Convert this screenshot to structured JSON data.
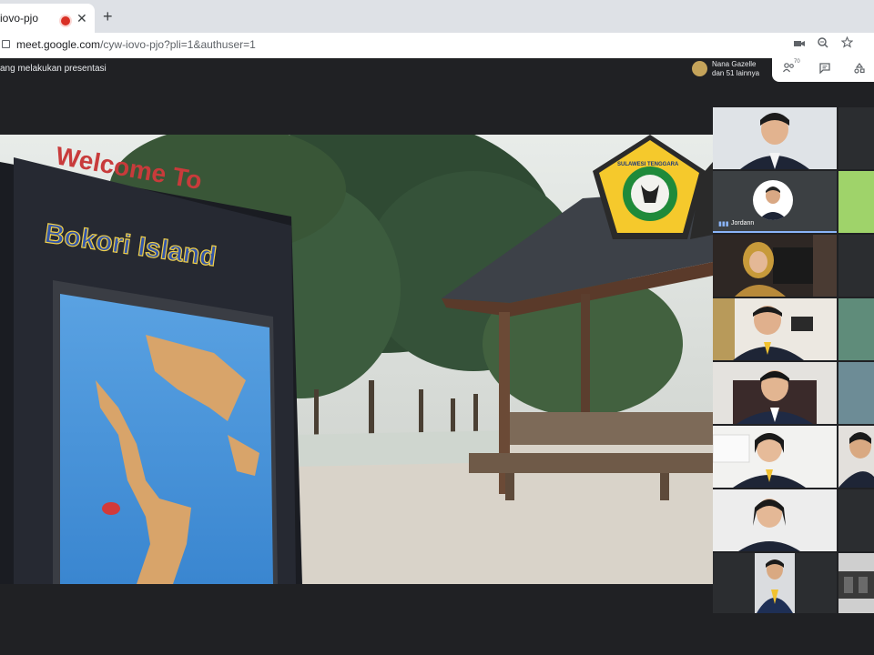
{
  "browser": {
    "tab_title": "iovo-pjo",
    "close_glyph": "✕",
    "new_tab_glyph": "+",
    "url_host": "meet.google.com",
    "url_path": "/cyw-iovo-pjo?pli=1&authuser=1"
  },
  "meet": {
    "presenting_text": "ang melakukan presentasi",
    "viewer_name": "Nana Gazelle",
    "viewer_more": "dan 51 lainnya",
    "people_count": "70",
    "speaking_label": "Jordann"
  },
  "presentation": {
    "sign_line1": "Welcome To",
    "sign_line2": "Bokori Island",
    "logo_text": "SULAWESI TENGGARA"
  },
  "icons": {
    "camera": "camera-icon",
    "zoom": "zoom-icon",
    "star": "star-icon",
    "people": "people-icon",
    "chat": "chat-icon",
    "activities": "activities-icon"
  },
  "colors": {
    "meet_bg": "#202124",
    "speaking_accent": "#8ab4f8",
    "record_red": "#d93025"
  }
}
